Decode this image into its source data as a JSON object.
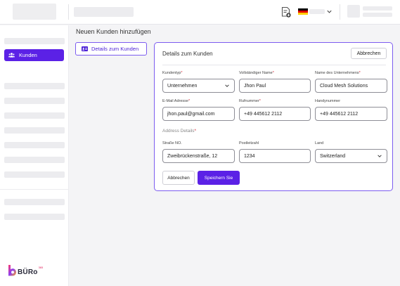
{
  "header": {
    "icons": [
      "document-plus-icon",
      "germany-flag-icon",
      "chevron-down-icon"
    ],
    "flag_colors": [
      "#000000",
      "#dd0000",
      "#ffce00"
    ]
  },
  "sidebar": {
    "active_item": {
      "label": "Kunden",
      "icon": "users-icon"
    },
    "brand": {
      "name": "BÜRo",
      "superscript": "365"
    }
  },
  "main": {
    "title": "Neuen Kunden hinzufügen",
    "tab": {
      "label": "Details zum Kunden",
      "icon": "id-card-icon"
    }
  },
  "form": {
    "title": "Details zum Kunden",
    "cancel_top_label": "Abbrechen",
    "fields": {
      "customer_type": {
        "label": "Kundentyp",
        "required": true,
        "value": "Unternehmen"
      },
      "full_name": {
        "label": "Vollständiger Name",
        "required": true,
        "value": "Jhon Paul"
      },
      "company_name": {
        "label": "Name des Unternehmens",
        "required": true,
        "value": "Cloud Mesh Solutions"
      },
      "email": {
        "label": "E-Mail Adresse",
        "required": true,
        "value": "jhon.paul@gmail.com"
      },
      "phone": {
        "label": "Rufnummer",
        "required": true,
        "value": "+49 445612 2112"
      },
      "mobile": {
        "label": "Handynummer",
        "required": false,
        "value": "+49 445612 2112"
      },
      "street": {
        "label": "Straße NO.",
        "required": false,
        "value": "Zweibrückenstraße, 12"
      },
      "postal_code": {
        "label": "Postleitzahl",
        "required": false,
        "value": "1234"
      },
      "country": {
        "label": "Land",
        "required": false,
        "value": "Switzerland"
      }
    },
    "address_section_label": "Address Details",
    "cancel_label": "Abbrechen",
    "save_label": "Speichern Sie"
  },
  "colors": {
    "accent": "#5b21e6",
    "required": "#d92a3a"
  }
}
